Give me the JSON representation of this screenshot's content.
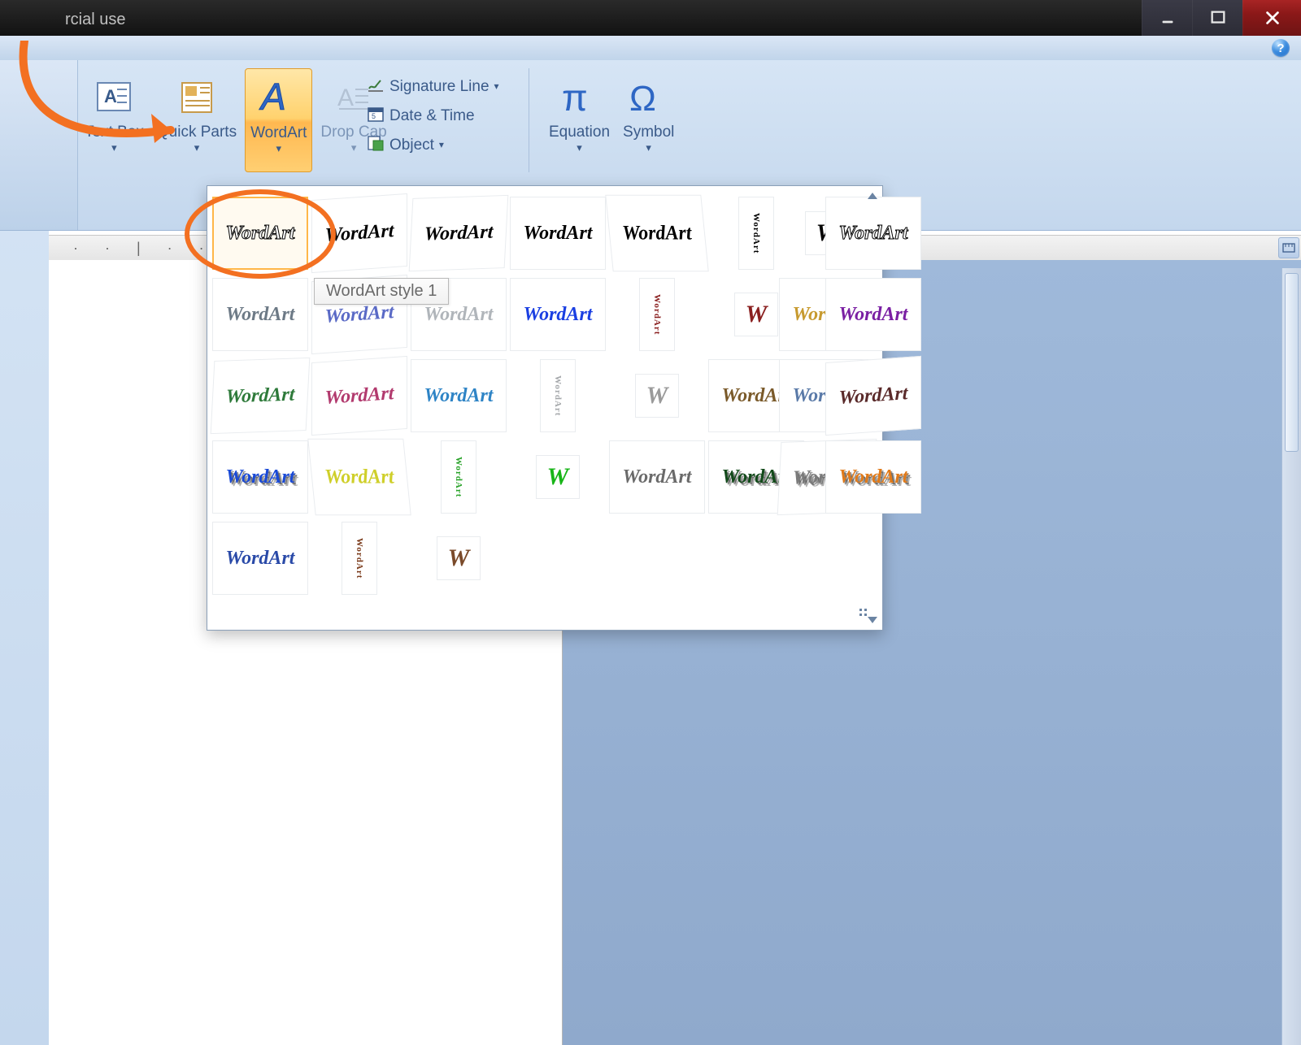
{
  "window": {
    "title_fragment": "rcial use"
  },
  "ribbon": {
    "text_box": "Text Box",
    "quick_parts": "Quick Parts",
    "wordart": "WordArt",
    "drop_cap": "Drop Cap",
    "signature_line": "Signature Line",
    "date_time": "Date & Time",
    "object": "Object",
    "equation": "Equation",
    "symbol": "Symbol",
    "drop_indicator": "▾"
  },
  "gallery": {
    "tooltip": "WordArt style 1",
    "label": "WordArt",
    "letter": "W",
    "rows": [
      {
        "items": [
          {
            "color": "#000",
            "cls": "wa-outline selected"
          },
          {
            "color": "#000",
            "cls": "wa-wave"
          },
          {
            "color": "#000",
            "cls": "wa-curve"
          },
          {
            "color": "#000",
            "cls": ""
          },
          {
            "color": "#000",
            "cls": "wa-arch"
          }
        ],
        "vcolor": "#000",
        "wcolor": "#000"
      },
      {
        "items": [
          {
            "color": "#9aa1a6",
            "cls": "wa-outline"
          },
          {
            "color": "#6d7a86",
            "cls": ""
          },
          {
            "color": "#5a6ac6",
            "cls": "wa-wave"
          },
          {
            "color": "#b0b5ba",
            "cls": ""
          },
          {
            "color": "#1a3fe2",
            "cls": ""
          }
        ],
        "vcolor": "#8a1f1f",
        "wcolor": "#8a1f1f"
      },
      {
        "items": [
          {
            "color": "#c79a2f",
            "cls": ""
          },
          {
            "color": "#7a1fa3",
            "cls": ""
          },
          {
            "color": "#2e7a3a",
            "cls": "wa-curve"
          },
          {
            "color": "#b23a6e",
            "cls": "wa-wave"
          },
          {
            "color": "#2e84c6",
            "cls": ""
          }
        ],
        "vcolor": "#a5a8ab",
        "wcolor": "#9a9a9a"
      },
      {
        "items": [
          {
            "color": "#7a5a2a",
            "cls": ""
          },
          {
            "color": "#5a7aa8",
            "cls": ""
          },
          {
            "color": "#5a2a2a",
            "cls": "wa-wave"
          },
          {
            "color": "#1a4ad6",
            "cls": "wa-3d"
          },
          {
            "color": "#cfcf2a",
            "cls": "wa-arch"
          }
        ],
        "vcolor": "#2aa32a",
        "wcolor": "#18b518"
      },
      {
        "items": [
          {
            "color": "#6a6a6a",
            "cls": ""
          },
          {
            "color": "#124a1a",
            "cls": "wa-3d"
          },
          {
            "color": "#7a7a7a",
            "cls": "wa-curve wa-3d"
          },
          {
            "color": "#e07a1a",
            "cls": "wa-3d"
          },
          {
            "color": "#2a4aa8",
            "cls": ""
          }
        ],
        "vcolor": "#7a3a1a",
        "wcolor": "#7a4a2a"
      }
    ]
  },
  "ruler": {
    "marks": "·  ·  |  ·  · 5"
  }
}
